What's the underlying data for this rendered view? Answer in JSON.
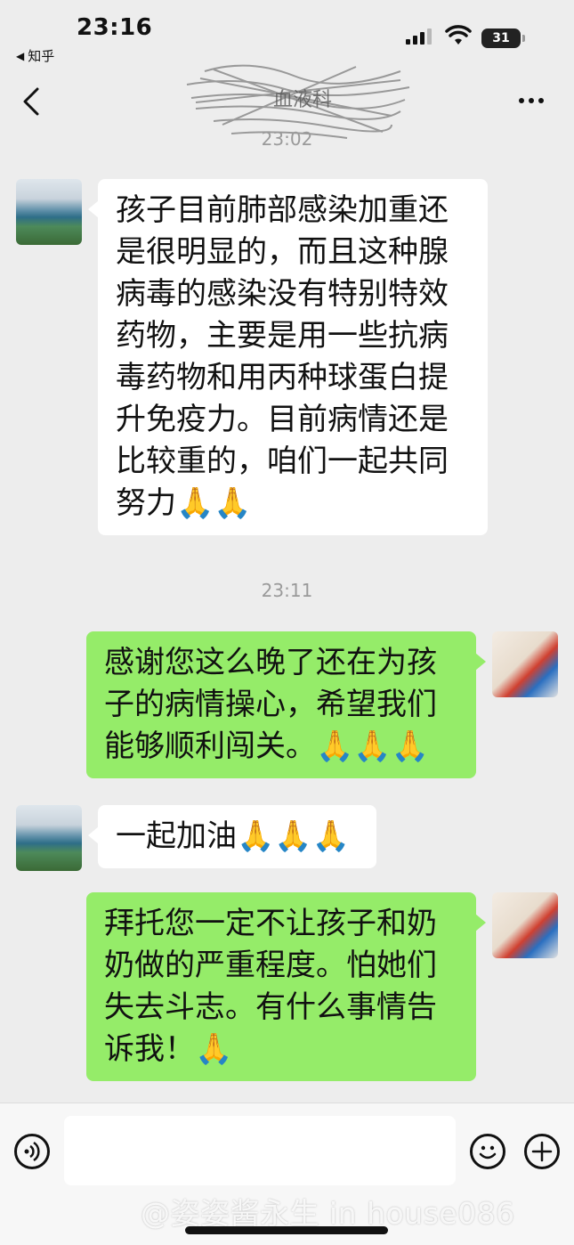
{
  "status_bar": {
    "time": "23:16",
    "back_app": "知乎",
    "battery": "31"
  },
  "nav": {
    "title": "血液科",
    "more_label": "..."
  },
  "messages": [
    {
      "type": "timestamp",
      "text": "23:02"
    },
    {
      "type": "left",
      "text": "孩子目前肺部感染加重还是很明显的，而且这种腺病毒的感染没有特别特效药物，主要是用一些抗病毒药物和用丙种球蛋白提升免疫力。目前病情还是比较重的，咱们一起共同努力🙏🙏"
    },
    {
      "type": "timestamp",
      "text": "23:11"
    },
    {
      "type": "right",
      "text": "感谢您这么晚了还在为孩子的病情操心，希望我们能够顺利闯关。🙏🙏🙏"
    },
    {
      "type": "left",
      "text": "一起加油🙏🙏🙏"
    },
    {
      "type": "right",
      "text": "拜托您一定不让孩子和奶奶做的严重程度。怕她们失去斗志。有什么事情告诉我！🙏"
    }
  ],
  "input": {
    "placeholder": ""
  },
  "watermark": "@姿姿酱永生 in house086",
  "colors": {
    "background": "#ededed",
    "self_bubble": "#95ec69",
    "other_bubble": "#ffffff"
  }
}
